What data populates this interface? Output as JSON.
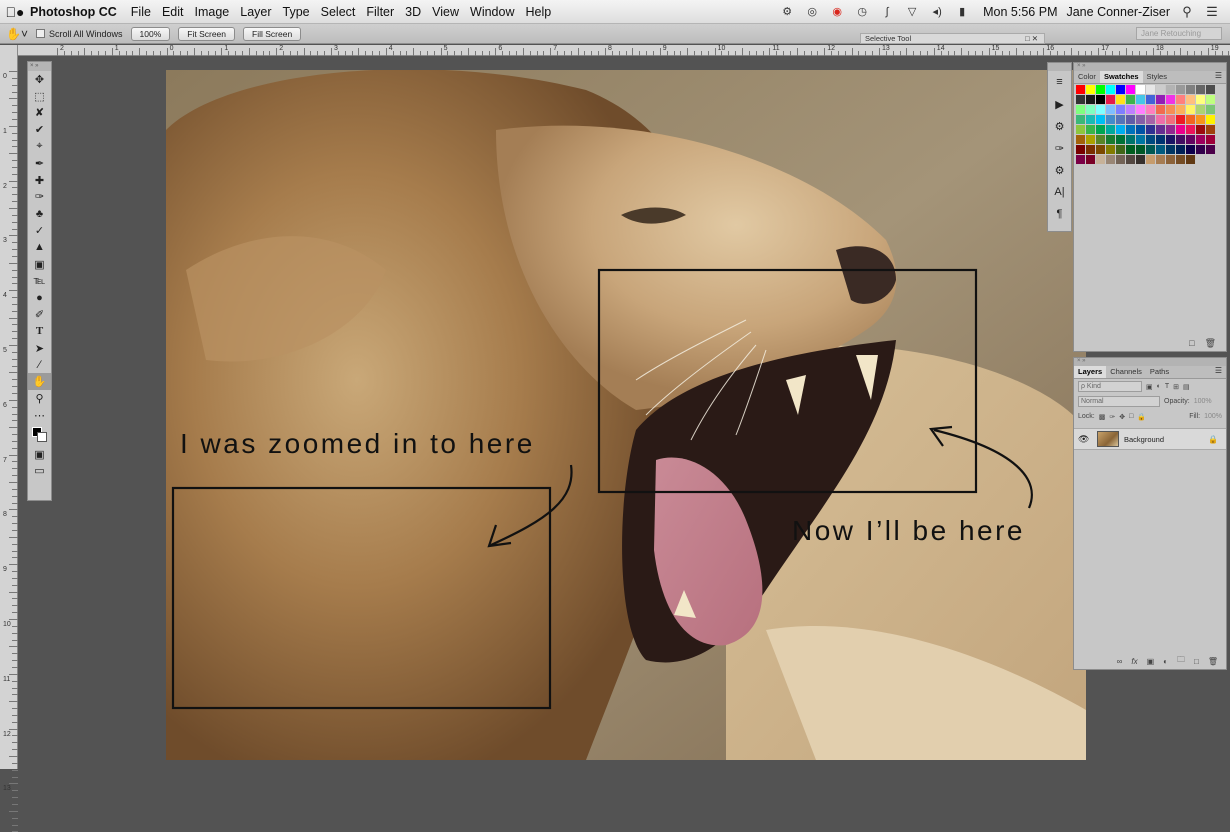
{
  "menubar": {
    "apple": "",
    "app": "Photoshop CC",
    "items": [
      "File",
      "Edit",
      "Image",
      "Layer",
      "Type",
      "Select",
      "Filter",
      "3D",
      "View",
      "Window",
      "Help"
    ],
    "clock": "Mon 5:56 PM",
    "user": "Jane Conner-Ziser"
  },
  "options": {
    "scroll_all": "Scroll All Windows",
    "btn_100": "100%",
    "btn_fit": "Fit Screen",
    "btn_fill": "Fill Screen",
    "workspace": "Jane Retouching"
  },
  "tooltip": {
    "label": "Selective Tool"
  },
  "ruler": {
    "top": [
      "2",
      "1",
      "0",
      "1",
      "2",
      "3",
      "4",
      "5",
      "6",
      "7",
      "8",
      "9",
      "10",
      "11",
      "12",
      "13",
      "14",
      "15",
      "16",
      "17",
      "18",
      "19"
    ],
    "left": [
      "0",
      "1",
      "2",
      "3",
      "4",
      "5",
      "6",
      "7",
      "8",
      "9",
      "10",
      "11",
      "12",
      "13"
    ]
  },
  "canvas": {
    "annotation_left": "I was zoomed in to here",
    "annotation_right": "Now I’ll be here"
  },
  "swatches_panel": {
    "tabs": [
      "Color",
      "Swatches",
      "Styles"
    ],
    "selected_tab": "Swatches",
    "colors": [
      "#ff0000",
      "#ffff00",
      "#00ff00",
      "#00ffff",
      "#0000ff",
      "#ff00ff",
      "#ffffff",
      "#e6e6e6",
      "#cccccc",
      "#b3b3b3",
      "#999999",
      "#808080",
      "#666666",
      "#4d4d4d",
      "#333333",
      "#1a1a1a",
      "#000000",
      "#e6194b",
      "#ffe119",
      "#3cb44b",
      "#46c6e8",
      "#4363d8",
      "#911eb4",
      "#f032e6",
      "#ff7f7f",
      "#ffbf7f",
      "#ffff7f",
      "#bfff7f",
      "#7fff7f",
      "#7fffbf",
      "#7fffff",
      "#7fbfff",
      "#7f7fff",
      "#bf7fff",
      "#ff7fff",
      "#ff7fbf",
      "#f26c4f",
      "#f68e55",
      "#fbaf5c",
      "#fff467",
      "#acd372",
      "#7cc576",
      "#3bb878",
      "#1abbb4",
      "#00bff3",
      "#438ccb",
      "#5574b9",
      "#605ca8",
      "#855fa8",
      "#a763a8",
      "#f06ea9",
      "#f26d7d",
      "#ed1c24",
      "#f26522",
      "#f7941d",
      "#fff200",
      "#8dc63f",
      "#39b54a",
      "#00a651",
      "#00a99d",
      "#00aeef",
      "#0072bc",
      "#0054a6",
      "#2e3192",
      "#662d91",
      "#92278f",
      "#ec008c",
      "#ed145b",
      "#9e0b0f",
      "#a0410d",
      "#a3620a",
      "#aba000",
      "#598527",
      "#197b30",
      "#007236",
      "#00746b",
      "#0076a3",
      "#004a80",
      "#003471",
      "#1b1464",
      "#440e62",
      "#630460",
      "#9e005d",
      "#9e0039",
      "#790000",
      "#7b2e00",
      "#7d4900",
      "#827b00",
      "#406618",
      "#005e20",
      "#005826",
      "#005952",
      "#005b7f",
      "#003663",
      "#002157",
      "#0d004c",
      "#32004b",
      "#4b0049",
      "#7b0046",
      "#7a0026",
      "#c7b299",
      "#998675",
      "#736357",
      "#534741",
      "#37302d",
      "#c69c6d",
      "#a67c52",
      "#8c6239",
      "#754c24",
      "#603913"
    ]
  },
  "layers_panel": {
    "tabs": [
      "Layers",
      "Channels",
      "Paths"
    ],
    "selected_tab": "Layers",
    "kind": "ρ Kind",
    "blend": "Normal",
    "opacity_label": "Opacity:",
    "opacity": "100%",
    "lock_label": "Lock:",
    "fill_label": "Fill:",
    "fill": "100%",
    "layer_name": "Background"
  }
}
